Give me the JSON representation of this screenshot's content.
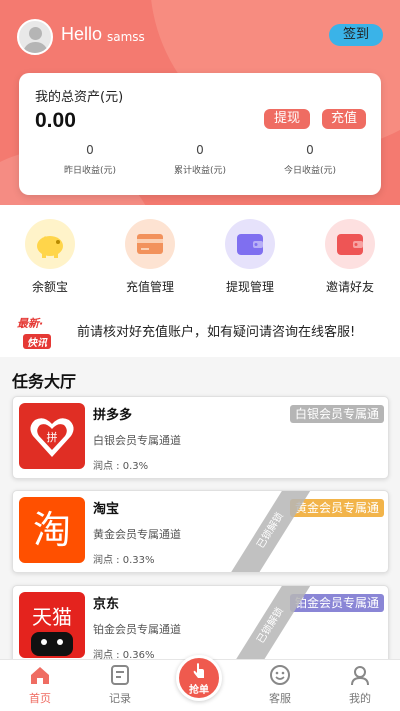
{
  "header": {
    "greeting": "Hello",
    "username": "samss",
    "signin_label": "签到"
  },
  "assets": {
    "title": "我的总资产(元)",
    "total": "0.00",
    "withdraw_label": "提现",
    "recharge_label": "充值",
    "stats": [
      {
        "value": "0",
        "label": "昨日收益(元)"
      },
      {
        "value": "0",
        "label": "累计收益(元)"
      },
      {
        "value": "0",
        "label": "今日收益(元)"
      }
    ]
  },
  "quick_actions": [
    {
      "label": "余额宝",
      "icon": "piggy-bank-icon",
      "color": "#ffe07a"
    },
    {
      "label": "充值管理",
      "icon": "card-icon",
      "color": "#f39a6b"
    },
    {
      "label": "提现管理",
      "icon": "wallet-icon",
      "color": "#8a7cf0"
    },
    {
      "label": "邀请好友",
      "icon": "gift-wallet-icon",
      "color": "#f0585a"
    }
  ],
  "notice": {
    "tag_top": "最新·",
    "tag_bottom": "快讯",
    "text": "前请核对好充值账户，如有疑问请咨询在线客服!"
  },
  "section_title": "任务大厅",
  "tasks": [
    {
      "name": "拼多多",
      "channel": "白银会员专属通道",
      "rate": "润点 : 0.3%",
      "badge": "白银会员专属通",
      "badge_color": "#b5b5b5",
      "locked": ""
    },
    {
      "name": "淘宝",
      "channel": "黄金会员专属通道",
      "rate": "润点 : 0.33%",
      "badge": "黄金会员专属通",
      "badge_color": "#f2b44a",
      "locked": "已锁解锁"
    },
    {
      "name": "京东",
      "channel": "铂金会员专属通道",
      "rate": "润点 : 0.36%",
      "badge": "铂金会员专属通",
      "badge_color": "#8a86d6",
      "locked": "已锁解锁"
    }
  ],
  "tabbar": {
    "home": "首页",
    "records": "记录",
    "grab": "抢单",
    "service": "客服",
    "mine": "我的"
  },
  "colors": {
    "brand": "#f47a70",
    "accent": "#ef6c62",
    "signin": "#3ab3e8"
  }
}
